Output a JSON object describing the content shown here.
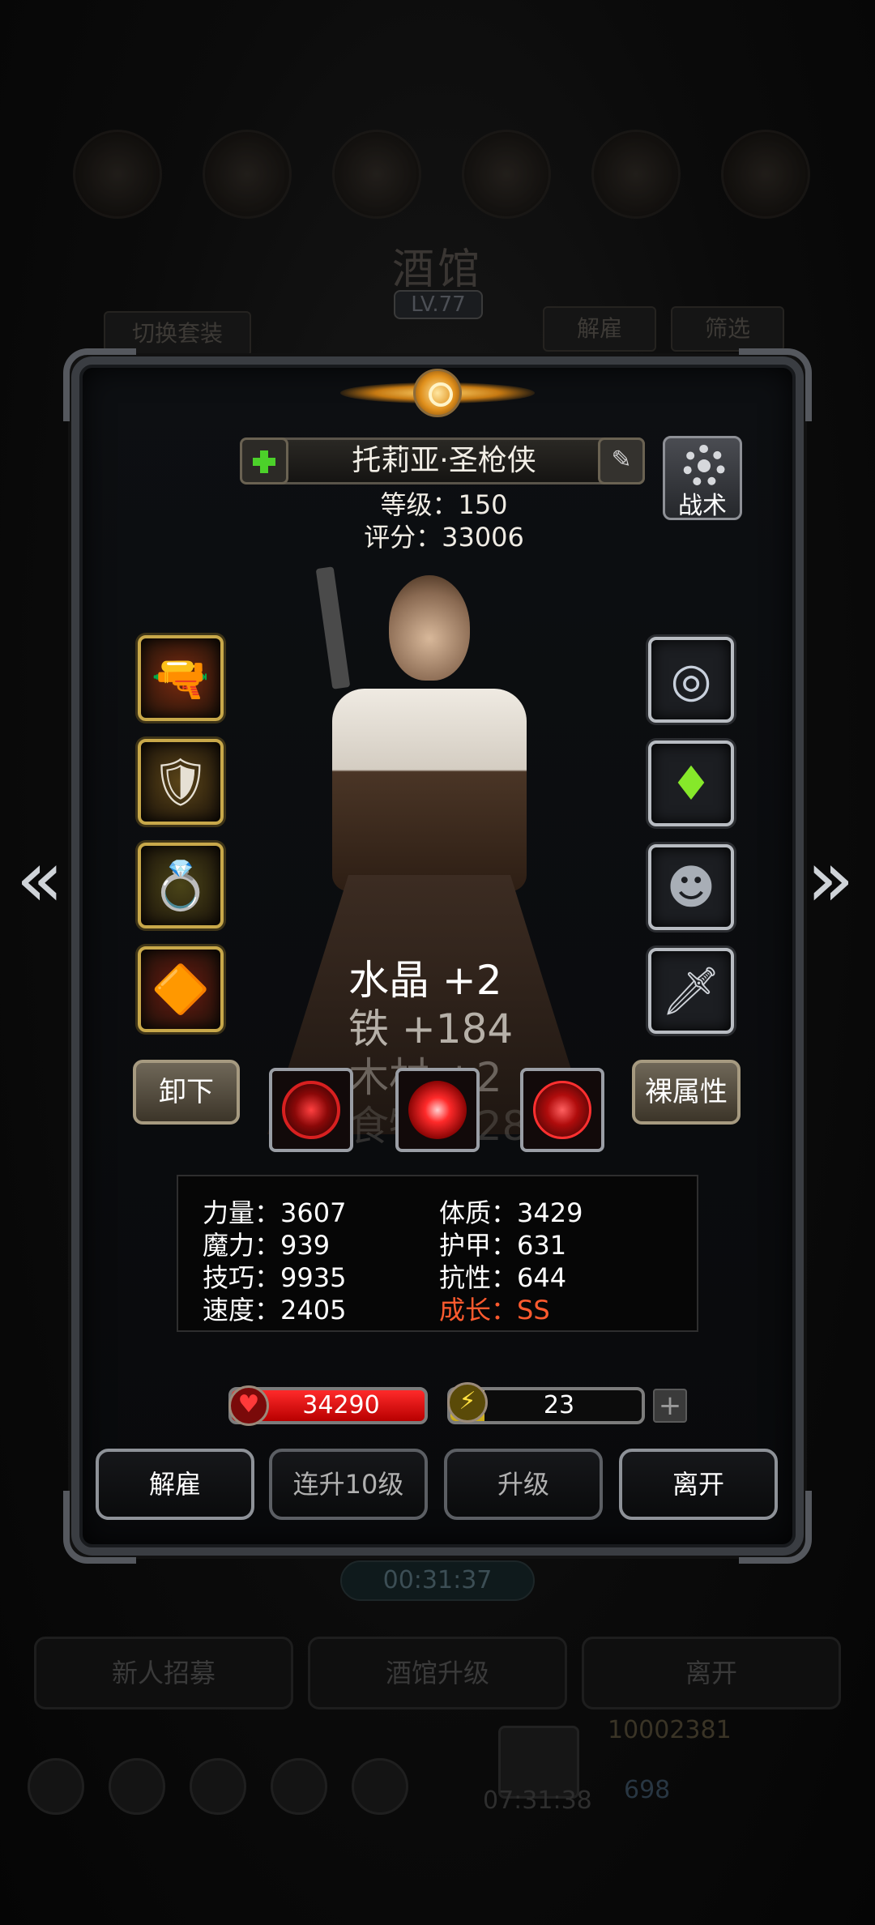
{
  "background": {
    "title": "酒馆",
    "level": "LV.77",
    "switch_outfit": "切换套装",
    "dismiss": "解雇",
    "filter": "筛选",
    "timer": "00:31:37",
    "bottom_buttons": [
      "新人招募",
      "酒馆升级",
      "离开"
    ],
    "gold": "10002381",
    "gems": "698",
    "gift_timer": "07:31:38"
  },
  "hero": {
    "name": "托莉亚·圣枪侠",
    "level_text": "等级：150",
    "score_text": "评分：33006",
    "tactics_label": "战术"
  },
  "equipment": {
    "left": [
      {
        "name": "rifle-icon",
        "glyph": "🔫",
        "bg": "#7a2a10"
      },
      {
        "name": "armor-icon",
        "glyph": "🛡",
        "bg": "#5a4418"
      },
      {
        "name": "ring-icon",
        "glyph": "💍",
        "bg": "#4a4418"
      },
      {
        "name": "amulet-icon",
        "glyph": "🔶",
        "bg": "#6a1a10"
      }
    ],
    "right": [
      {
        "name": "silver-amulet-icon",
        "glyph": "◎"
      },
      {
        "name": "green-crystal-icon",
        "glyph": "♦"
      },
      {
        "name": "mask-icon",
        "glyph": "☻"
      },
      {
        "name": "dagger-icon",
        "glyph": "🗡"
      }
    ]
  },
  "floating_resources": [
    "水晶 +2",
    "铁 +184",
    "木材 +2",
    "食物 +28"
  ],
  "actions": {
    "unequip": "卸下",
    "base_attributes": "裸属性"
  },
  "stats": {
    "strength": "力量：3607",
    "constitution": "体质：3429",
    "magic": "魔力：939",
    "armor": "护甲：631",
    "skill": "技巧：9935",
    "resistance": "抗性：644",
    "speed": "速度：2405",
    "growth": "成长：SS"
  },
  "hp": "34290",
  "energy": {
    "value": "23",
    "fill_fraction": 0.18
  },
  "buttons": {
    "dismiss": "解雇",
    "level_up_10": "连升10级",
    "level_up": "升级",
    "leave": "离开"
  },
  "colors": {
    "growth": "#ff5a2e",
    "hp": "#d80000",
    "energy": "#e0c82a"
  }
}
